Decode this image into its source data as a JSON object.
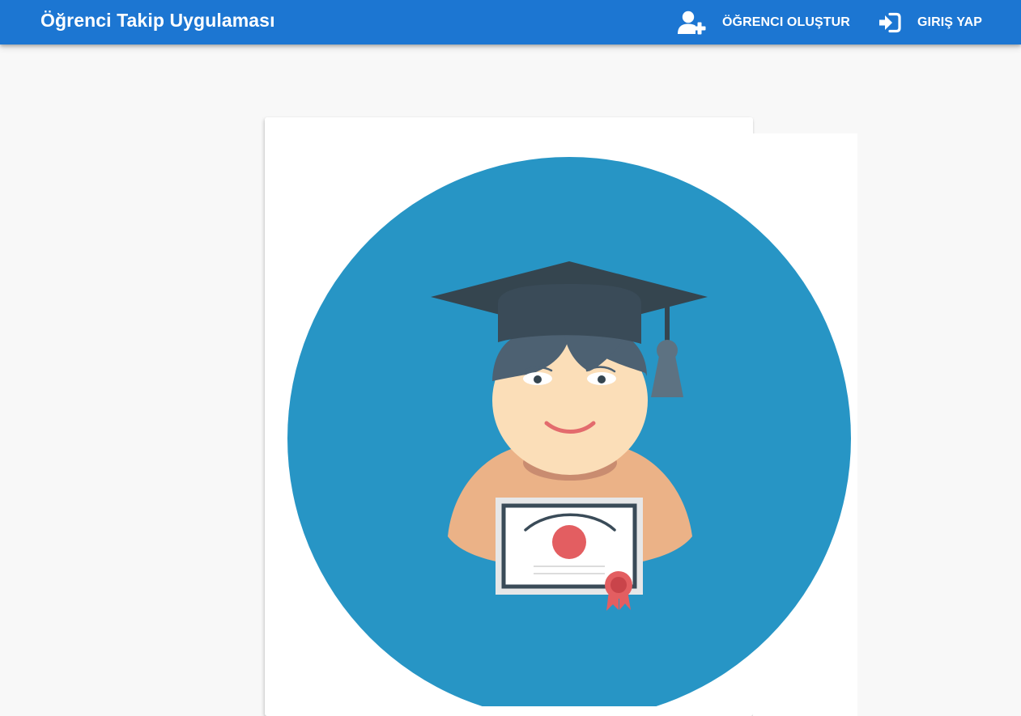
{
  "appbar": {
    "title": "Öğrenci Takip Uygulaması",
    "background": "#1c76d2",
    "actions": [
      {
        "label": "ÖĞRENCI OLUŞTUR",
        "icon": "user-plus-icon"
      },
      {
        "label": "GIRIŞ YAP",
        "icon": "sign-in-icon"
      }
    ]
  },
  "main": {
    "illustration": {
      "subject": "graduate-student-icon",
      "colors": {
        "circle": "#2795c5",
        "cap": "#35454f",
        "skin": "#fbdeb8",
        "body": "#ebb287",
        "diploma_seal": "#e35e61"
      }
    }
  }
}
